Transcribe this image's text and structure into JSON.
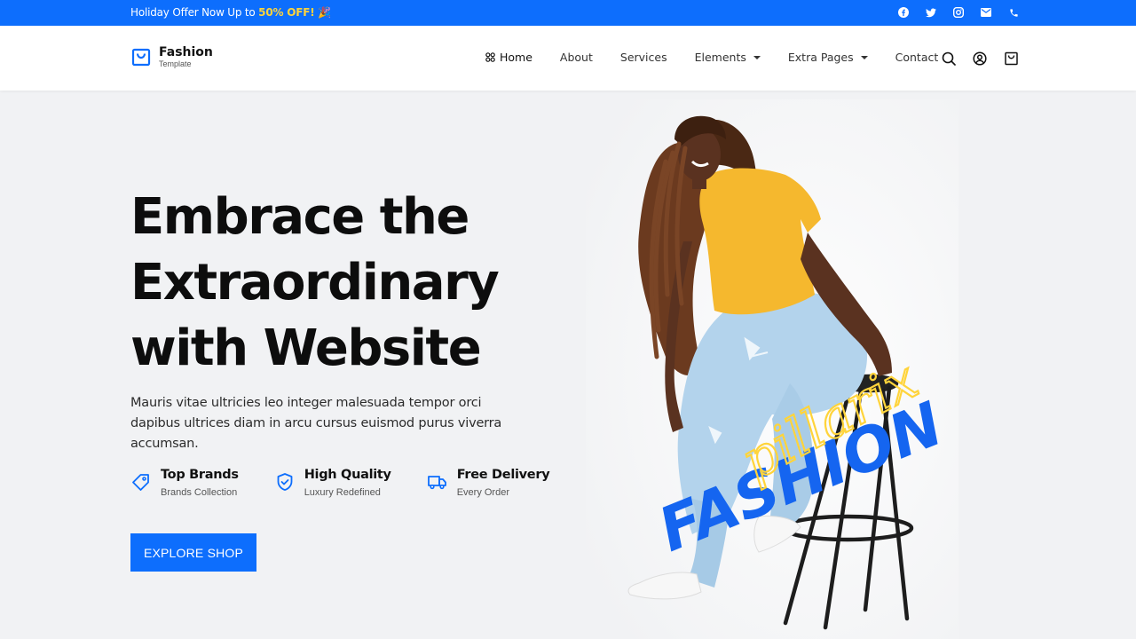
{
  "topbar": {
    "offer_text": "Holiday Offer Now Up to ",
    "offer_highlight": "50% OFF!",
    "offer_emoji": "🎉",
    "social_icons": [
      "facebook-icon",
      "twitter-icon",
      "instagram-icon",
      "mail-icon",
      "phone-icon"
    ]
  },
  "header": {
    "logo_brand": "Fashion",
    "logo_sub": "Template",
    "nav": [
      {
        "label": "Home",
        "active": true
      },
      {
        "label": "About"
      },
      {
        "label": "Services"
      },
      {
        "label": "Elements",
        "dropdown": true
      },
      {
        "label": "Extra Pages",
        "dropdown": true
      },
      {
        "label": "Contact"
      }
    ],
    "icons": [
      "search-icon",
      "user-icon",
      "cart-icon"
    ]
  },
  "hero": {
    "title_lines": [
      "Embrace the",
      "Extraordinary",
      "with Website"
    ],
    "description": "Mauris vitae ultricies leo integer malesuada tempor orci dapibus ultrices diam in arcu cursus euismod purus viverra accumsan.",
    "features": [
      {
        "title": "Top Brands",
        "subtitle": "Brands Collection",
        "icon": "tag-icon"
      },
      {
        "title": "High Quality",
        "subtitle": "Luxury Redefined",
        "icon": "shield-check-icon"
      },
      {
        "title": "Free Delivery",
        "subtitle": "Every Order",
        "icon": "truck-icon"
      }
    ],
    "cta_label": "EXPLORE SHOP",
    "image_overlay_script": "pillarix",
    "image_overlay_word": "FASHION"
  },
  "colors": {
    "accent": "#0d6efd",
    "highlight": "#ffd43b",
    "shirt": "#f5b82e",
    "jeans": "#aecde8"
  }
}
